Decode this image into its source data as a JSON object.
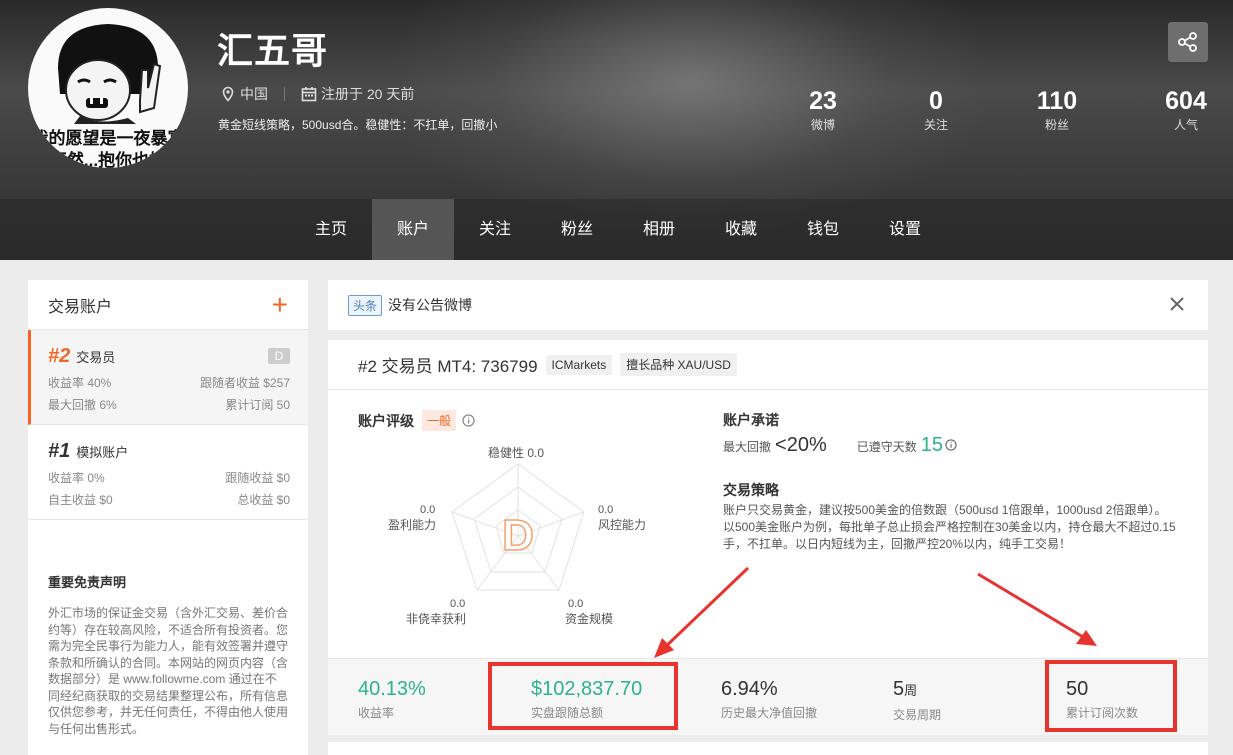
{
  "profile": {
    "name": "汇五哥",
    "location": "中国",
    "registered": "注册于 20 天前",
    "bio": "黄金短线策略，500usd合。稳健性：不扛单，回撤小",
    "avatar_caption_1": "我的愿望是一夜暴富",
    "avatar_caption_2": "不然...抱你也好"
  },
  "stats": [
    {
      "num": "23",
      "label": "微博"
    },
    {
      "num": "0",
      "label": "关注"
    },
    {
      "num": "110",
      "label": "粉丝"
    },
    {
      "num": "604",
      "label": "人气"
    }
  ],
  "nav": [
    "主页",
    "账户",
    "关注",
    "粉丝",
    "相册",
    "收藏",
    "钱包",
    "设置"
  ],
  "nav_active": "账户",
  "sidebar": {
    "title": "交易账户",
    "accounts": [
      {
        "rank": "#2",
        "role": "交易员",
        "badge": "D",
        "l1": "收益率 40%",
        "r1": "跟随者收益 $257",
        "l2": "最大回撤 6%",
        "r2": "累计订阅 50"
      },
      {
        "rank": "#1",
        "role": "模拟账户",
        "l1": "收益率 0%",
        "r1": "跟随收益 $0",
        "l2": "自主收益 $0",
        "r2": "总收益 $0"
      }
    ],
    "disclaimer_title": "重要免责声明",
    "disclaimer_body": "外汇市场的保证金交易（含外汇交易、差价合约等）存在较高风险，不适合所有投资者。您需为完全民事行为能力人，能有效签署并遵守条款和所确认的合同。本网站的网页内容（含数据部分）是 www.followme.com 通过在不同经纪商获取的交易结果整理公布，所有信息仅供您参考，并无任何责任，不得由他人使用与任何出售形式。"
  },
  "announcement": {
    "tag": "头条",
    "text": "没有公告微博"
  },
  "account_card": {
    "title": "#2 交易员 MT4: 736799",
    "broker": "ICMarkets",
    "specialty": "擅长品种 XAU/USD",
    "rating_label": "账户评级",
    "rating_level": "一般",
    "grade": "D",
    "radar": [
      {
        "label": "稳健性",
        "value": "0.0"
      },
      {
        "label": "风控能力",
        "value": "0.0"
      },
      {
        "label": "资金规模",
        "value": "0.0"
      },
      {
        "label": "非侥幸获利",
        "value": "0.0"
      },
      {
        "label": "盈利能力",
        "value": "0.0"
      }
    ],
    "promise_title": "账户承诺",
    "max_drawdown_label": "最大回撤",
    "max_drawdown_value": "<20%",
    "days_label": "已遵守天数",
    "days_value": "15",
    "strategy_title": "交易策略",
    "strategy_text": "账户只交易黄金，建议按500美金的倍数跟（500usd 1倍跟单，1000usd 2倍跟单）。以500美金账户为例，每批单子总止损会严格控制在30美金以内，持仓最大不超过0.15手，不扛单。以日内短线为主，回撤严控20%以内，纯手工交易！"
  },
  "metrics": [
    {
      "value": "40.13%",
      "label": "收益率"
    },
    {
      "value": "$102,837.70",
      "label": "实盘跟随总额"
    },
    {
      "value": "6.94%",
      "label": "历史最大净值回撤"
    },
    {
      "value": "5",
      "unit": "周",
      "label": "交易周期"
    },
    {
      "value": "50",
      "label": "累计订阅次数"
    }
  ],
  "colors": {
    "accent": "#f26522",
    "green": "#2bb38a",
    "annotation_red": "#e8342e"
  }
}
